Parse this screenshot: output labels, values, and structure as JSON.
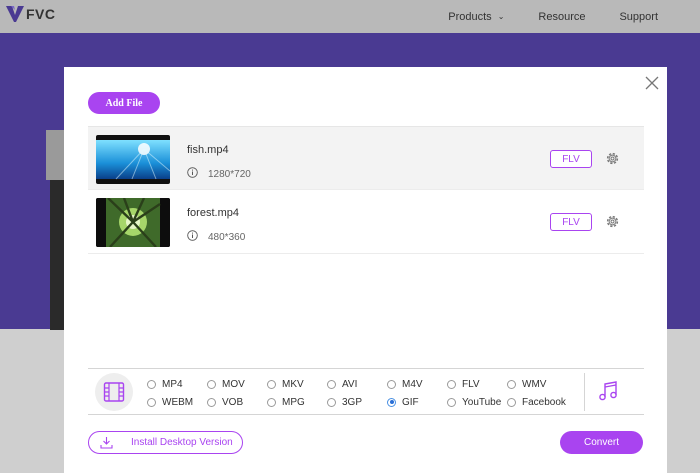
{
  "brand": {
    "name": "FVC"
  },
  "nav": {
    "items": [
      {
        "label": "Products"
      },
      {
        "label": "Resource"
      },
      {
        "label": "Support"
      }
    ]
  },
  "colors": {
    "accent": "#a944f0",
    "hero": "#4a3a92"
  },
  "dialog": {
    "add_file_label": "Add File",
    "files": [
      {
        "name": "fish.mp4",
        "resolution": "1280*720",
        "format": "FLV"
      },
      {
        "name": "forest.mp4",
        "resolution": "480*360",
        "format": "FLV"
      }
    ],
    "formats_row1": [
      "MP4",
      "MOV",
      "MKV",
      "AVI",
      "M4V",
      "FLV",
      "WMV"
    ],
    "formats_row2": [
      "WEBM",
      "VOB",
      "MPG",
      "3GP",
      "GIF",
      "YouTube",
      "Facebook"
    ],
    "selected_format": "GIF",
    "install_label": "Install Desktop Version",
    "convert_label": "Convert"
  }
}
